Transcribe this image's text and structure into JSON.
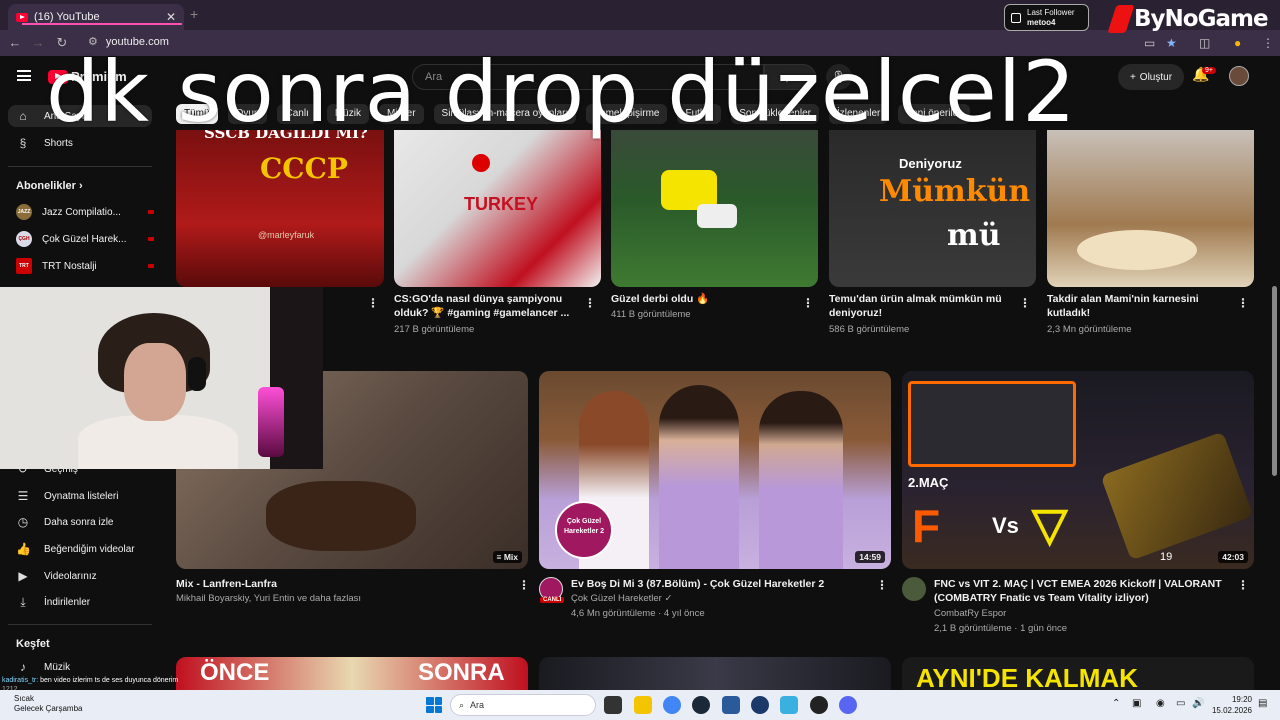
{
  "browser": {
    "tab_title": "(16) YouTube",
    "tab_close": "✕",
    "new_tab": "+",
    "url": "youtube.com"
  },
  "stream_overlay": {
    "follower_title": "Last Follower",
    "follower_name": "metoo4",
    "sponsor": "ByNoGame",
    "title_text": "dk sonra drop düzelcel2",
    "chat_user": "kadiratis_tr:",
    "chat_message": "ben video izlerim ts de ses duyunca dönerim",
    "chat_extra": "1212"
  },
  "youtube": {
    "logo": "Premium",
    "search_placeholder": "Ara",
    "create_label": "Oluştur",
    "notif_count": "9+",
    "chips": [
      "Tümü",
      "Oyun",
      "Canlı",
      "Müzik",
      "Mix'ler",
      "Simülasyon-macera oyunları",
      "Yemek pişirme",
      "Futbol",
      "Son yüklenenler",
      "İzlenenler",
      "Yeni öneriler"
    ]
  },
  "sidebar": {
    "home": "Ana Sayfa",
    "shorts": "Shorts",
    "subscriptions_head": "Abonelikler",
    "subscriptions": [
      {
        "name": "Jazz Compilatio...",
        "avatar": "JAZZ",
        "color": "#8a6d3b"
      },
      {
        "name": "Çok Güzel Harek...",
        "avatar": "ÇGH",
        "color": "#d9d9e8"
      },
      {
        "name": "TRT Nostalji",
        "avatar": "TRT",
        "color": "#c00"
      }
    ],
    "history": "Geçmiş",
    "playlists": "Oynatma listeleri",
    "watch_later": "Daha sonra izle",
    "liked": "Beğendiğim videolar",
    "your_videos": "Videolarınız",
    "downloads": "İndirilenler",
    "explore_head": "Keşfet",
    "music": "Müzik"
  },
  "videos_row1": [
    {
      "title": "",
      "meta": "",
      "thumb_text": "SSCB DAĞILDI MI?",
      "thumb_sub": "CCCP",
      "watermark": "@marleyfaruk"
    },
    {
      "title1": "CS:GO'da nasıl dünya şampiyonu",
      "title2": "olduk? 🏆 #gaming #gamelancer ...",
      "meta": "217 B görüntüleme",
      "thumb_text": "TURKEY"
    },
    {
      "title1": "Güzel derbi oldu 🔥",
      "title2": "",
      "meta": "411 B görüntüleme"
    },
    {
      "title1": "Temu'dan ürün almak mümkün mü",
      "title2": "deniyoruz!",
      "meta": "586 B görüntüleme",
      "thumb_t1": "Deniyoruz",
      "thumb_t2": "Mümkün",
      "thumb_t3": "mü"
    },
    {
      "title1": "Takdir alan Mami'nin karnesini",
      "title2": "kutladık!",
      "meta": "2,3 Mn görüntüleme"
    }
  ],
  "videos_row2": [
    {
      "title": "Mix - Lanfren-Lanfra",
      "channel": "Mikhail Boyarskiy, Yuri Entin ve daha fazlası",
      "badge": "Mix"
    },
    {
      "title": "Ev Boş Di Mi 3 (87.Bölüm) - Çok Güzel Hareketler 2",
      "channel": "Çok Güzel Hareketler ✓",
      "meta": "4,6 Mn görüntüleme · 4 yıl önce",
      "duration": "14:59",
      "live_badge": "CANLI",
      "logo_text": "Çok Güzel Hareketler 2"
    },
    {
      "title1": "FNC vs VIT 2. MAÇ | VCT EMEA 2026 Kickoff | VALORANT",
      "title2": "(COMBATRY Fnatic vs Team Vitality izliyor)",
      "channel": "CombatRy Espor",
      "meta": "2,1 B görüntüleme · 1 gün önce",
      "duration": "42:03",
      "thumb_mac": "2.MAÇ",
      "vs": "Vs",
      "score": "19"
    }
  ],
  "videos_row3": [
    {
      "t1": "ÖNCE",
      "t2": "SONRA"
    },
    {},
    {
      "t1": "AYNI'DE KALMAK"
    }
  ],
  "taskbar": {
    "weather1": "Sıcak",
    "weather2": "Gelecek Çarşamba",
    "search": "Ara",
    "time": "19:20",
    "date": "15.02.2026"
  },
  "colors": {
    "youtube_red": "#ff0033",
    "bg": "#0f0f0f",
    "tabbar": "#2a2233"
  }
}
